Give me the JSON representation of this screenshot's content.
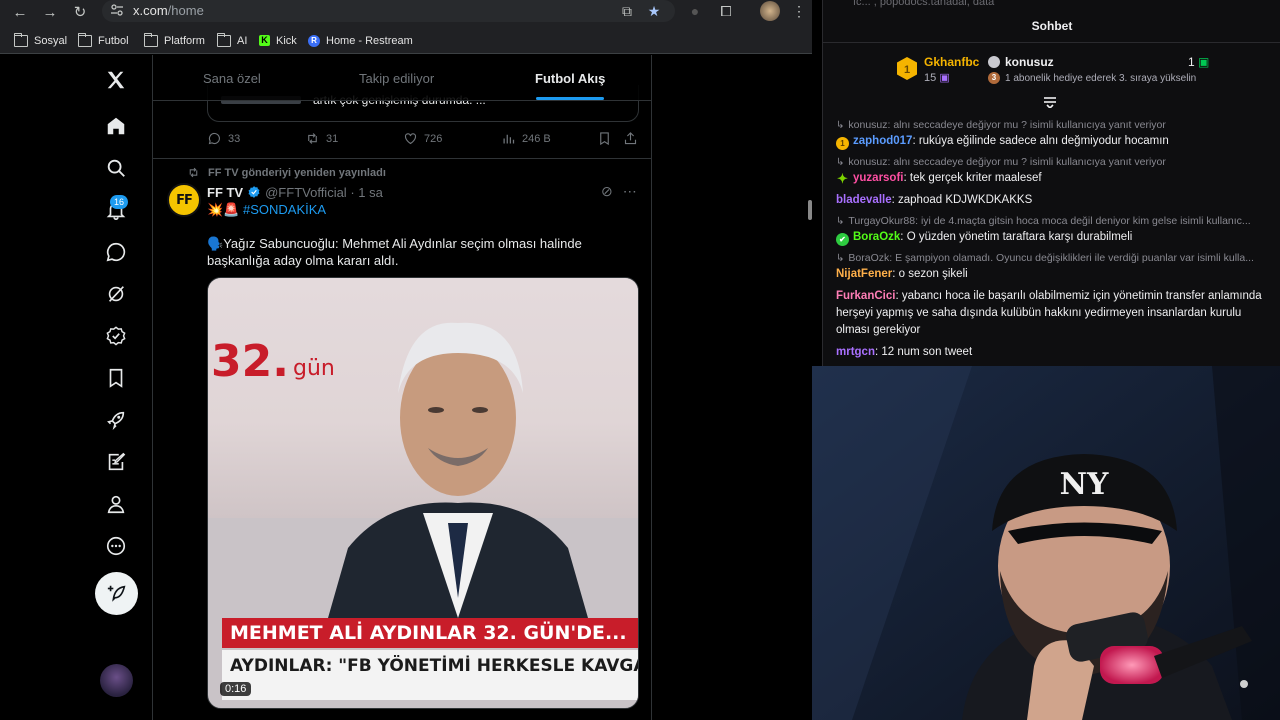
{
  "browser": {
    "url_domain": "x.com",
    "url_path": "/home",
    "bookmarks": [
      {
        "label": "Sosyal",
        "icon": "folder-icon"
      },
      {
        "label": "Futbol",
        "icon": "folder-icon"
      },
      {
        "label": "Platform",
        "icon": "folder-icon"
      },
      {
        "label": "AI",
        "icon": "folder-icon"
      },
      {
        "label": "Kick",
        "icon": "kick-icon"
      },
      {
        "label": "Home - Restream",
        "icon": "restream-icon"
      }
    ]
  },
  "x": {
    "notification_count": "16",
    "tabs": [
      "Sana özel",
      "Takip ediliyor",
      "Futbol Akış"
    ],
    "active_tab": "Futbol Akış",
    "prev_tweet": {
      "quote_text": "artık çok genişlemiş durumda. ...",
      "replies": "33",
      "reposts": "31",
      "likes": "726",
      "views": "246 B"
    },
    "tweet": {
      "repost_context": "FF TV gönderiyi yeniden yayınladı",
      "avatar_text": "FF",
      "name": "FF TV",
      "handle": "@FFTVofficial",
      "time": "· 1 sa",
      "emoji_line": "💥🚨",
      "hashtag": "#SONDAKİKA",
      "body": "🗣️Yağız Sabuncuoğlu: Mehmet Ali Aydınlar seçim olması halinde başkanlığa aday olma kararı aldı.",
      "media": {
        "channel_number": "32.",
        "channel_word": "gün",
        "caption_top": "MEHMET ALİ AYDINLAR 32. GÜN'DE...",
        "caption_bottom": "AYDINLAR: \"FB YÖNETİMİ HERKESLE KAVGALI\"",
        "duration": "0:16"
      }
    }
  },
  "chat": {
    "top_text": "fc... , popodocs.tanadai, data",
    "title": "Sohbet",
    "leaderboard": {
      "rank": "1",
      "top_gifter": "Gkhanfbc",
      "top_gifter_count": "15",
      "user": "konusuz",
      "user_count": "1",
      "hint_rank": "3",
      "hint": "1 abonelik hediye ederek 3. sıraya yükselin"
    },
    "messages": [
      {
        "reply_to": "konusuz: alnı seccadeye değiyor mu ? isimli kullanıcıya yanıt veriyor",
        "user": "zaphod017",
        "color": "#5b9cff",
        "badge": "1",
        "badge_color": "#f5b400",
        "text": "rukúya eğilinde sadece alnı değmiyodur hocamın"
      },
      {
        "reply_to": "konusuz: alnı seccadeye değiyor mu ? isimli kullanıcıya yanıt veriyor",
        "user": "yuzarsofi",
        "color": "#ff4fa3",
        "badge": "✦",
        "badge_color": "#7cd300",
        "text": "tek gerçek kriter maalesef"
      },
      {
        "reply_to": "",
        "user": "bladevalle",
        "color": "#a970ff",
        "badge": "",
        "badge_color": "",
        "text": "zaphoad KDJWKDKAKKS"
      },
      {
        "reply_to": "TurgayOkur88: iyi de 4.maçta gitsin hoca moca değil deniyor kim gelse isimli kullanıc...",
        "user": "BoraOzk",
        "color": "#53fc18",
        "badge": "✔",
        "badge_color": "#2ecc40",
        "text": "O yüzden yönetim taraftara karşı durabilmeli"
      },
      {
        "reply_to": "BoraOzk: E şampiyon olamadı. Oyuncu değişiklikleri ile verdiği puanlar var isimli kulla...",
        "user": "NijatFener",
        "color": "#ffb04a",
        "badge": "",
        "badge_color": "",
        "text": "o sezon şikeli"
      },
      {
        "reply_to": "",
        "user": "FurkanCici",
        "color": "#ff7eb6",
        "badge": "",
        "badge_color": "",
        "text": "yabancı hoca ile başarılı olabilmemiz için yönetimin transfer anlamında herşeyi yapmış ve saha dışında kulübün hakkını yedirmeyen insanlardan kurulu olması gerekiyor"
      },
      {
        "reply_to": "",
        "user": "mrtgcn",
        "color": "#a970ff",
        "badge": "",
        "badge_color": "",
        "text": "12 num son tweet"
      }
    ]
  },
  "colors": {
    "x_blue": "#1d9bf0",
    "kick_green": "#53fc18",
    "news_red": "#c81d2a"
  }
}
